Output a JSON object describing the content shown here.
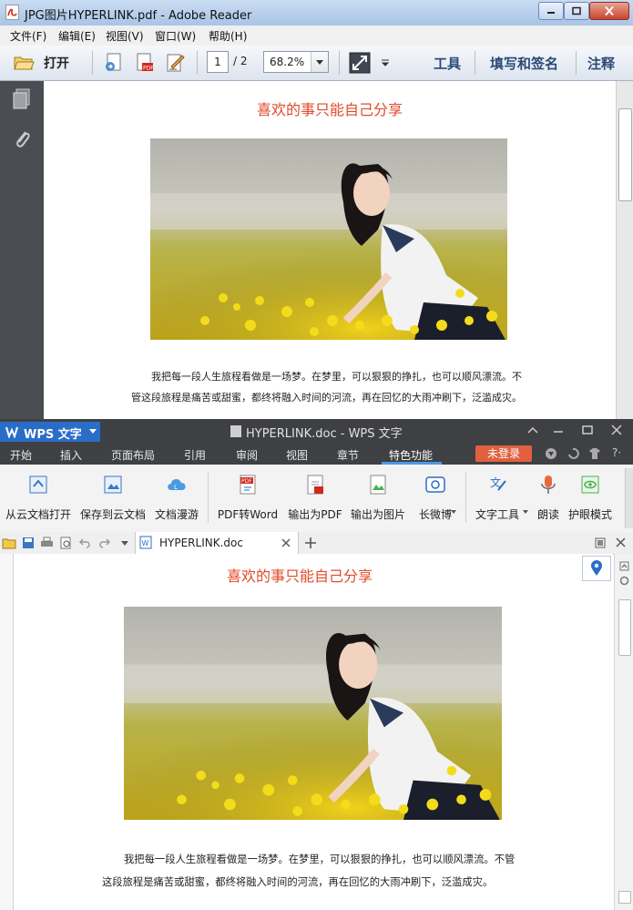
{
  "reader": {
    "title": "JPG图片HYPERLINK.pdf - Adobe Reader",
    "menu": [
      "文件(F)",
      "编辑(E)",
      "视图(V)",
      "窗口(W)",
      "帮助(H)"
    ],
    "open_label": "打开",
    "page_current": "1",
    "page_total": "/ 2",
    "zoom": "68.2%",
    "right_tools": [
      "工具",
      "填写和签名",
      "注释"
    ],
    "doc": {
      "heading": "喜欢的事只能自己分享",
      "para_line1": "我把每一段人生旅程看做是一场梦。在梦里，可以狠狠的挣扎，也可以顺风漂流。不",
      "para_line2": "管这段旅程是痛苦或甜蜜，都终将融入时间的河流，再在回忆的大雨冲刷下，泛滥成灾。"
    }
  },
  "wps": {
    "app_name": "WPS 文字",
    "title": "HYPERLINK.doc - WPS 文字",
    "tabs": [
      "开始",
      "插入",
      "页面布局",
      "引用",
      "审阅",
      "视图",
      "章节",
      "特色功能"
    ],
    "active_tab": "特色功能",
    "login_label": "未登录",
    "ribbon": [
      "从云文档打开",
      "保存到云文档",
      "文档漫游",
      "PDF转Word",
      "输出为PDF",
      "输出为图片",
      "长微博",
      "文字工具",
      "朗读",
      "护眼模式"
    ],
    "doc_tab": "HYPERLINK.doc",
    "doc": {
      "heading": "喜欢的事只能自己分享",
      "para_line1": "我把每一段人生旅程看做是一场梦。在梦里，可以狠狠的挣扎，也可以顺风漂流。不管",
      "para_line2": "这段旅程是痛苦或甜蜜，都终将融入时间的河流，再在回忆的大雨冲刷下，泛滥成灾。"
    }
  },
  "colors": {
    "heading": "#e04a2a",
    "wps_accent": "#2a6dc9",
    "login": "#e2603f"
  }
}
